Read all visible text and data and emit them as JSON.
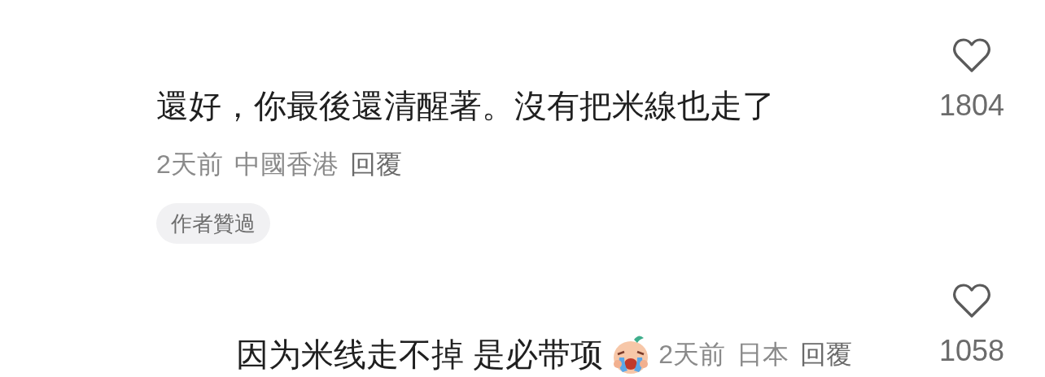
{
  "comments": [
    {
      "kind": "top",
      "text": "還好，你最後還清醒著。沒有把米線也走了",
      "time": "2天前",
      "location": "中國香港",
      "reply": "回覆",
      "badge": "作者贊過",
      "likes": "1804",
      "liked": false,
      "sticker": false
    },
    {
      "kind": "reply",
      "text": "因为米线走不掉 是必带项",
      "time": "2天前",
      "location": "日本",
      "reply": "回覆",
      "likes": "1058",
      "liked": false,
      "sticker": true
    }
  ]
}
